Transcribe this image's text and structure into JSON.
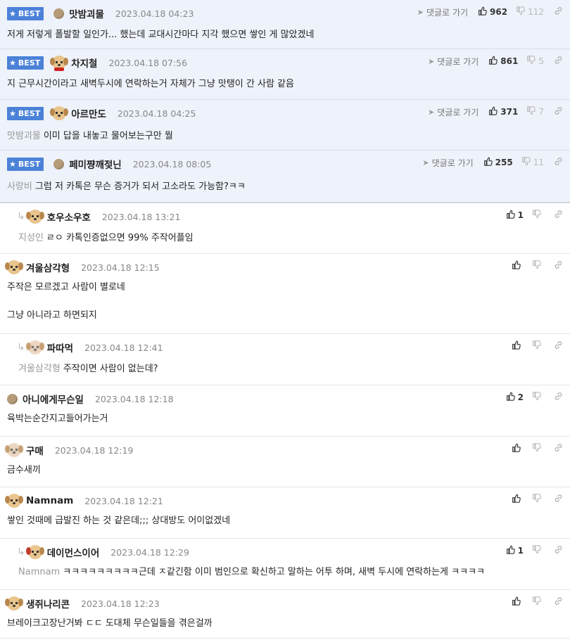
{
  "labels": {
    "goto": "댓글로 가기",
    "best": "BEST"
  },
  "comments": [
    {
      "id": "c1",
      "best": true,
      "avatar": "dot",
      "name": "맛밤괴물",
      "date": "2023.04.18 04:23",
      "likes": "962",
      "dislikes": "112",
      "to": "",
      "lines": [
        "저게 저렇게 폴발할 일인가... 했는데 교대시간마다 지각 했으면 쌓인 게 많았겠네"
      ]
    },
    {
      "id": "c2",
      "best": true,
      "avatar": "dog-red",
      "name": "차지철",
      "date": "2023.04.18 07:56",
      "likes": "861",
      "dislikes": "5",
      "to": "",
      "lines": [
        "지 근무시간이라고 새벽두시에 연락하는거 자체가 그냥 맛탱이 간 사람 같음"
      ]
    },
    {
      "id": "c3",
      "best": true,
      "avatar": "dog",
      "name": "아르만도",
      "date": "2023.04.18 04:25",
      "likes": "371",
      "dislikes": "7",
      "to": "맛밤괴물",
      "lines": [
        "이미 답을 내놓고 물어보는구만 뭘"
      ]
    },
    {
      "id": "c4",
      "best": true,
      "avatar": "dot",
      "name": "페미쨩깨젖닌",
      "date": "2023.04.18 08:05",
      "likes": "255",
      "dislikes": "11",
      "to": "사랑비",
      "lines": [
        "그럼 저 카톡은 무슨 증거가 되서 고소라도 가능함?ㅋㅋ"
      ]
    },
    {
      "id": "c5",
      "reply": true,
      "avatar": "dog",
      "name": "호우소우호",
      "date": "2023.04.18 13:21",
      "likes": "1",
      "to": "지성인",
      "lines": [
        "ㄹㅇ 카톡인증없으면 99% 주작어플임"
      ]
    },
    {
      "id": "c6",
      "avatar": "dog",
      "name": "겨울삼각형",
      "date": "2023.04.18 12:15",
      "likes": "",
      "to": "",
      "lines": [
        "주작은 모르겠고 사람이 별로네",
        "",
        "그냥 아니라고 하면되지"
      ]
    },
    {
      "id": "c7",
      "reply": true,
      "avatar": "blur",
      "name": "파따먹",
      "date": "2023.04.18 12:41",
      "likes": "",
      "to": "겨울삼각형",
      "lines": [
        "주작이면 사람이 없는데?"
      ]
    },
    {
      "id": "c8",
      "avatar": "dot",
      "name": "아니에게무슨일",
      "date": "2023.04.18 12:18",
      "likes": "2",
      "to": "",
      "lines": [
        "육박는순간지고들어가는거"
      ]
    },
    {
      "id": "c9",
      "avatar": "blur",
      "name": "구매",
      "date": "2023.04.18 12:19",
      "likes": "",
      "to": "",
      "lines": [
        "금수새끼"
      ]
    },
    {
      "id": "c10",
      "avatar": "dog",
      "name": "Namnam",
      "date": "2023.04.18 12:21",
      "likes": "",
      "to": "",
      "lines": [
        "쌓인 것때메 급발진 하는 것 같은데;;; 상대방도 어이없겠네"
      ]
    },
    {
      "id": "c11",
      "reply": true,
      "avatar": "santa",
      "name": "데이먼스이어",
      "date": "2023.04.18 12:29",
      "likes": "1",
      "to": "Namnam",
      "lines": [
        "ㅋㅋㅋㅋㅋㅋㅋㅋㅋ근데 ㅈ같긴함 이미 범인으로 확신하고 말하는 어투 하며, 새벽 두시에 연락하는게 ㅋㅋㅋㅋ"
      ]
    },
    {
      "id": "c12",
      "avatar": "dog",
      "name": "생쥐나리콘",
      "date": "2023.04.18 12:23",
      "likes": "",
      "to": "",
      "lines": [
        "브레이크고장난거봐 ㄷㄷ 도대체 무슨일들을 겪은걸까"
      ]
    }
  ]
}
